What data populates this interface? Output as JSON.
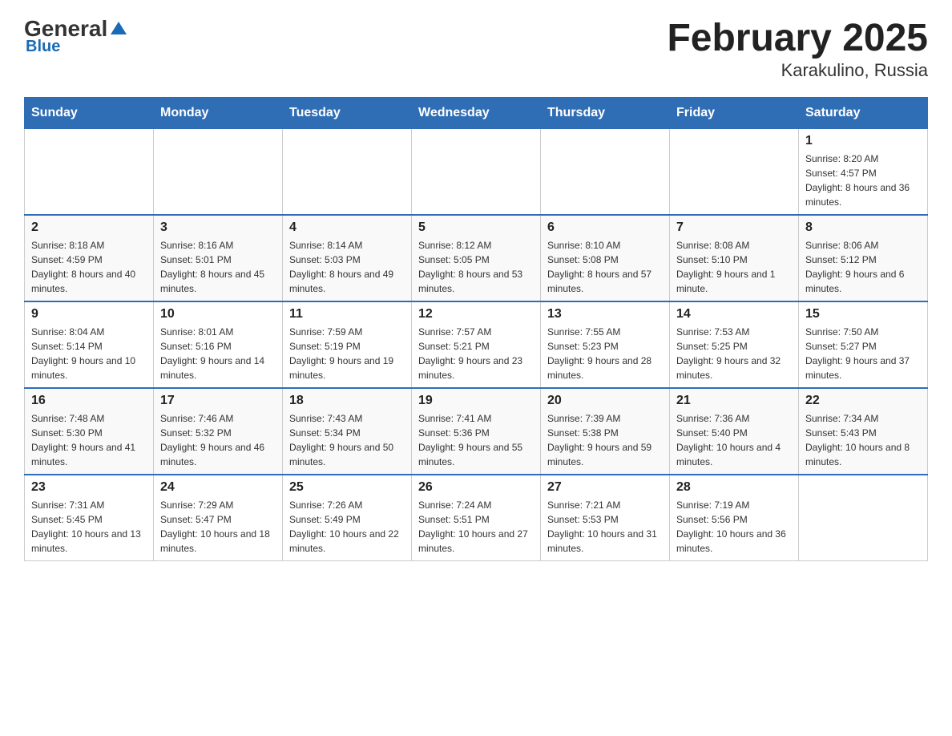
{
  "header": {
    "logo": {
      "general": "General",
      "blue": "Blue"
    },
    "title": "February 2025",
    "location": "Karakulino, Russia"
  },
  "calendar": {
    "days_of_week": [
      "Sunday",
      "Monday",
      "Tuesday",
      "Wednesday",
      "Thursday",
      "Friday",
      "Saturday"
    ],
    "weeks": [
      [
        {
          "day": "",
          "info": ""
        },
        {
          "day": "",
          "info": ""
        },
        {
          "day": "",
          "info": ""
        },
        {
          "day": "",
          "info": ""
        },
        {
          "day": "",
          "info": ""
        },
        {
          "day": "",
          "info": ""
        },
        {
          "day": "1",
          "info": "Sunrise: 8:20 AM\nSunset: 4:57 PM\nDaylight: 8 hours and 36 minutes."
        }
      ],
      [
        {
          "day": "2",
          "info": "Sunrise: 8:18 AM\nSunset: 4:59 PM\nDaylight: 8 hours and 40 minutes."
        },
        {
          "day": "3",
          "info": "Sunrise: 8:16 AM\nSunset: 5:01 PM\nDaylight: 8 hours and 45 minutes."
        },
        {
          "day": "4",
          "info": "Sunrise: 8:14 AM\nSunset: 5:03 PM\nDaylight: 8 hours and 49 minutes."
        },
        {
          "day": "5",
          "info": "Sunrise: 8:12 AM\nSunset: 5:05 PM\nDaylight: 8 hours and 53 minutes."
        },
        {
          "day": "6",
          "info": "Sunrise: 8:10 AM\nSunset: 5:08 PM\nDaylight: 8 hours and 57 minutes."
        },
        {
          "day": "7",
          "info": "Sunrise: 8:08 AM\nSunset: 5:10 PM\nDaylight: 9 hours and 1 minute."
        },
        {
          "day": "8",
          "info": "Sunrise: 8:06 AM\nSunset: 5:12 PM\nDaylight: 9 hours and 6 minutes."
        }
      ],
      [
        {
          "day": "9",
          "info": "Sunrise: 8:04 AM\nSunset: 5:14 PM\nDaylight: 9 hours and 10 minutes."
        },
        {
          "day": "10",
          "info": "Sunrise: 8:01 AM\nSunset: 5:16 PM\nDaylight: 9 hours and 14 minutes."
        },
        {
          "day": "11",
          "info": "Sunrise: 7:59 AM\nSunset: 5:19 PM\nDaylight: 9 hours and 19 minutes."
        },
        {
          "day": "12",
          "info": "Sunrise: 7:57 AM\nSunset: 5:21 PM\nDaylight: 9 hours and 23 minutes."
        },
        {
          "day": "13",
          "info": "Sunrise: 7:55 AM\nSunset: 5:23 PM\nDaylight: 9 hours and 28 minutes."
        },
        {
          "day": "14",
          "info": "Sunrise: 7:53 AM\nSunset: 5:25 PM\nDaylight: 9 hours and 32 minutes."
        },
        {
          "day": "15",
          "info": "Sunrise: 7:50 AM\nSunset: 5:27 PM\nDaylight: 9 hours and 37 minutes."
        }
      ],
      [
        {
          "day": "16",
          "info": "Sunrise: 7:48 AM\nSunset: 5:30 PM\nDaylight: 9 hours and 41 minutes."
        },
        {
          "day": "17",
          "info": "Sunrise: 7:46 AM\nSunset: 5:32 PM\nDaylight: 9 hours and 46 minutes."
        },
        {
          "day": "18",
          "info": "Sunrise: 7:43 AM\nSunset: 5:34 PM\nDaylight: 9 hours and 50 minutes."
        },
        {
          "day": "19",
          "info": "Sunrise: 7:41 AM\nSunset: 5:36 PM\nDaylight: 9 hours and 55 minutes."
        },
        {
          "day": "20",
          "info": "Sunrise: 7:39 AM\nSunset: 5:38 PM\nDaylight: 9 hours and 59 minutes."
        },
        {
          "day": "21",
          "info": "Sunrise: 7:36 AM\nSunset: 5:40 PM\nDaylight: 10 hours and 4 minutes."
        },
        {
          "day": "22",
          "info": "Sunrise: 7:34 AM\nSunset: 5:43 PM\nDaylight: 10 hours and 8 minutes."
        }
      ],
      [
        {
          "day": "23",
          "info": "Sunrise: 7:31 AM\nSunset: 5:45 PM\nDaylight: 10 hours and 13 minutes."
        },
        {
          "day": "24",
          "info": "Sunrise: 7:29 AM\nSunset: 5:47 PM\nDaylight: 10 hours and 18 minutes."
        },
        {
          "day": "25",
          "info": "Sunrise: 7:26 AM\nSunset: 5:49 PM\nDaylight: 10 hours and 22 minutes."
        },
        {
          "day": "26",
          "info": "Sunrise: 7:24 AM\nSunset: 5:51 PM\nDaylight: 10 hours and 27 minutes."
        },
        {
          "day": "27",
          "info": "Sunrise: 7:21 AM\nSunset: 5:53 PM\nDaylight: 10 hours and 31 minutes."
        },
        {
          "day": "28",
          "info": "Sunrise: 7:19 AM\nSunset: 5:56 PM\nDaylight: 10 hours and 36 minutes."
        },
        {
          "day": "",
          "info": ""
        }
      ]
    ]
  }
}
